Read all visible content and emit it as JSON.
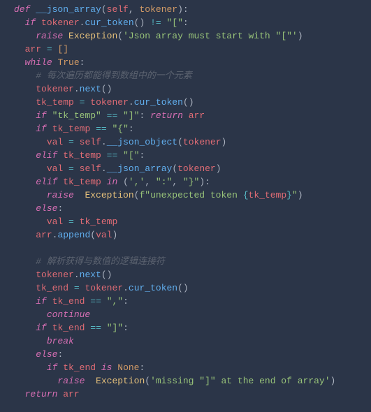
{
  "code": {
    "l1": {
      "def": "def",
      "name": "__json_array",
      "self": "self",
      "param": "tokener"
    },
    "l2": {
      "if": "if",
      "obj": "tokener",
      "method": "cur_token",
      "op": "!=",
      "str": "\"[\""
    },
    "l3": {
      "raise": "raise",
      "cls": "Exception",
      "str": "'Json array must start with \"[\"'"
    },
    "l4": {
      "var": "arr",
      "assign": "=",
      "val": "[]"
    },
    "l5": {
      "while": "while",
      "bool": "True"
    },
    "l6": {
      "comment": "# 每次遍历都能得到数组中的一个元素"
    },
    "l7": {
      "obj": "tokener",
      "method": "next"
    },
    "l8": {
      "var": "tk_temp",
      "assign": "=",
      "obj": "tokener",
      "method": "cur_token"
    },
    "l9": {
      "if": "if",
      "str1": "\"tk_temp\"",
      "op": "==",
      "str2": "\"]\"",
      "ret": "return",
      "retvar": "arr"
    },
    "l10": {
      "if": "if",
      "var": "tk_temp",
      "op": "==",
      "str": "\"{\""
    },
    "l11": {
      "var": "val",
      "assign": "=",
      "self": "self",
      "method": "__json_object",
      "arg": "tokener"
    },
    "l12": {
      "elif": "elif",
      "var": "tk_temp",
      "op": "==",
      "str": "\"[\""
    },
    "l13": {
      "var": "val",
      "assign": "=",
      "self": "self",
      "method": "__json_array",
      "arg": "tokener"
    },
    "l14": {
      "elif": "elif",
      "var": "tk_temp",
      "in": "in",
      "tuple": "(',', \":\", \"}\")"
    },
    "l15": {
      "raise": "raise",
      "cls": "Exception",
      "fstr1": "f\"unexpected token ",
      "fexpr": "{tk_temp}",
      "fstr2": "\""
    },
    "l16": {
      "else": "else"
    },
    "l17": {
      "var": "val",
      "assign": "=",
      "var2": "tk_temp"
    },
    "l18": {
      "obj": "arr",
      "method": "append",
      "arg": "val"
    },
    "l20": {
      "comment": "# 解析获得与数值的逻辑连接符"
    },
    "l21": {
      "obj": "tokener",
      "method": "next"
    },
    "l22": {
      "var": "tk_end",
      "assign": "=",
      "obj": "tokener",
      "method": "cur_token"
    },
    "l23": {
      "if": "if",
      "var": "tk_end",
      "op": "==",
      "str": "\",\""
    },
    "l24": {
      "continue": "continue"
    },
    "l25": {
      "if": "if",
      "var": "tk_end",
      "op": "==",
      "str": "\"]\""
    },
    "l26": {
      "break": "break"
    },
    "l27": {
      "else": "else"
    },
    "l28": {
      "if": "if",
      "var": "tk_end",
      "is": "is",
      "none": "None"
    },
    "l29": {
      "raise": "raise",
      "cls": "Exception",
      "str": "'missing \"]\" at the end of array'"
    },
    "l30": {
      "return": "return",
      "var": "arr"
    }
  }
}
